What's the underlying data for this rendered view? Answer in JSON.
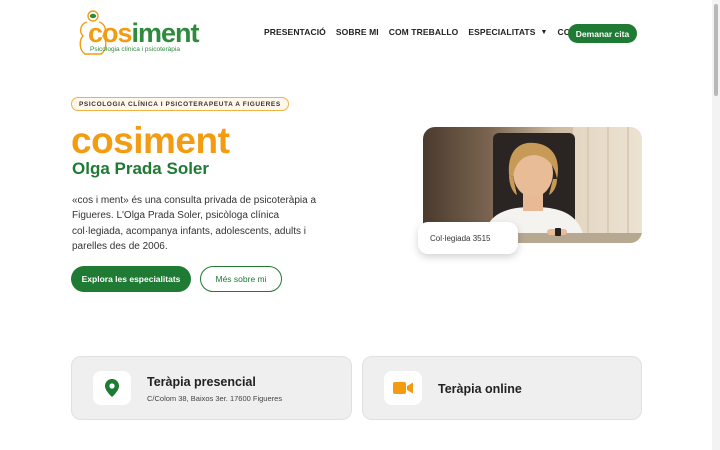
{
  "header": {
    "logo": {
      "word_part1": "cos",
      "word_part2": "iment",
      "tagline": "Psicologia clínica i psicoteràpia"
    },
    "nav": [
      {
        "label": "PRESENTACIÓ"
      },
      {
        "label": "SOBRE MI"
      },
      {
        "label": "COM TREBALLO"
      },
      {
        "label": "ESPECIALITATS",
        "has_dropdown": true
      },
      {
        "label": "CONTACTE"
      }
    ],
    "cta_label": "Demanar cita"
  },
  "hero": {
    "badge": "PSICOLOGIA CLÍNICA I PSICOTERAPEUTA A FIGUERES",
    "title": "cosiment",
    "subtitle": "Olga Prada Soler",
    "text": "«cos i ment» és una consulta privada de psicoteràpia a Figueres. L'Olga Prada Soler, psicòloga clínica col·legiada, acompanya infants, adolescents, adults i parelles des de 2006.",
    "primary_button": "Explora les especialitats",
    "secondary_button": "Més sobre mi",
    "photo_badge": "Col·legiada 3515"
  },
  "cards": [
    {
      "title": "Teràpia presencial",
      "subtitle": "C/Colom 38, Baixos 3er. 17600 Figueres",
      "icon": "location-pin-icon"
    },
    {
      "title": "Teràpia online",
      "icon": "video-camera-icon"
    }
  ],
  "colors": {
    "brand_orange": "#f39c12",
    "brand_green": "#1f7a34"
  }
}
